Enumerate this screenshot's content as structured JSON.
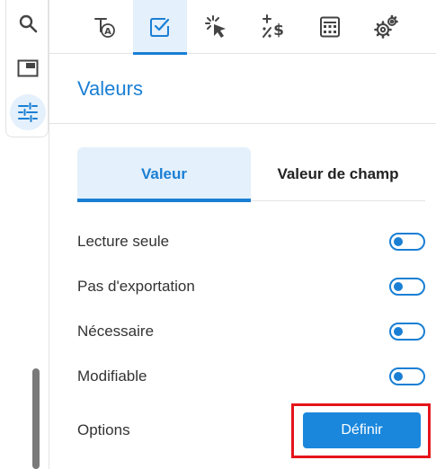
{
  "rail": {
    "items": [
      {
        "icon": "search-icon",
        "active": false
      },
      {
        "icon": "panel-icon",
        "active": false
      },
      {
        "icon": "sliders-icon",
        "active": true
      }
    ]
  },
  "toolbar": {
    "tabs": [
      {
        "icon": "text-field-icon",
        "active": false
      },
      {
        "icon": "checkbox-icon",
        "active": true
      },
      {
        "icon": "click-action-icon",
        "active": false
      },
      {
        "icon": "calculation-icon",
        "active": false
      },
      {
        "icon": "calculator-icon",
        "active": false
      },
      {
        "icon": "gears-icon",
        "active": false
      }
    ]
  },
  "section": {
    "title": "Valeurs"
  },
  "segment": {
    "valeur_label": "Valeur",
    "champ_label": "Valeur de champ"
  },
  "toggles": [
    {
      "label": "Lecture seule",
      "on": true
    },
    {
      "label": "Pas d'exportation",
      "on": true
    },
    {
      "label": "Nécessaire",
      "on": true
    },
    {
      "label": "Modifiable",
      "on": true
    }
  ],
  "options": {
    "label": "Options",
    "button_label": "Définir"
  },
  "colors": {
    "accent": "#1a7fd4",
    "active_bg": "#e4f0fb",
    "highlight": "#e5141b"
  }
}
